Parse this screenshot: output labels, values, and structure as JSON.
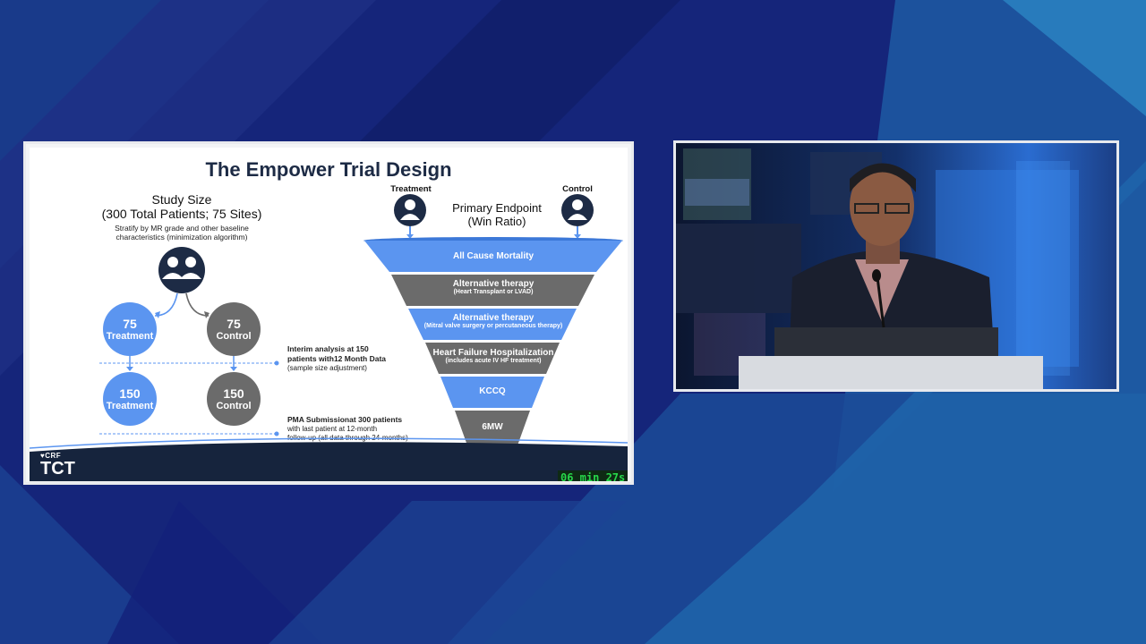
{
  "slide": {
    "title": "The Empower Trial Design",
    "study_size": {
      "heading_line1": "Study Size",
      "heading_line2": "(300 Total Patients; 75 Sites)",
      "stratify_line1": "Stratify by MR grade and other baseline",
      "stratify_line2": "characteristics (minimization algorithm)"
    },
    "arms": {
      "stage1": [
        {
          "number": "75",
          "label": "Treatment",
          "color": "#5b95f0"
        },
        {
          "number": "75",
          "label": "Control",
          "color": "#6b6b6b"
        }
      ],
      "stage2": [
        {
          "number": "150",
          "label": "Treatment",
          "color": "#5b95f0"
        },
        {
          "number": "150",
          "label": "Control",
          "color": "#6b6b6b"
        }
      ]
    },
    "interim": {
      "line1": "Interim analysis at 150",
      "line2": "patients with12 Month Data",
      "line3": "(sample size adjustment)"
    },
    "pma": {
      "line1": "PMA Submissionat 300 patients",
      "line2": "with last patient at 12-month",
      "line3": "follow-up (all data through 24-months)"
    },
    "endpoint": {
      "treatment_label": "Treatment",
      "control_label": "Control",
      "title_line1": "Primary Endpoint",
      "title_line2": "(Win Ratio)"
    },
    "funnel": [
      {
        "label": "All Cause Mortality",
        "sub": "",
        "color": "#5b95f0"
      },
      {
        "label": "Alternative therapy",
        "sub": "(Heart Transplant or LVAD)",
        "color": "#6b6b6b"
      },
      {
        "label": "Alternative therapy",
        "sub": "(Mitral valve surgery or percutaneous therapy)",
        "color": "#5b95f0"
      },
      {
        "label": "Heart Failure Hospitalization",
        "sub": "(includes acute IV HF treatment)",
        "color": "#6b6b6b"
      },
      {
        "label": "KCCQ",
        "sub": "",
        "color": "#5b95f0"
      },
      {
        "label": "6MW",
        "sub": "",
        "color": "#6b6b6b"
      }
    ],
    "logo": {
      "crf": "CRF",
      "tct": "TCT"
    },
    "timer": "06 min 27s"
  },
  "colors": {
    "background": "#15257a",
    "accent_blue": "#5b95f0",
    "dark_navy": "#1d2b45",
    "timer_green": "#27d84a"
  },
  "video": {
    "description_icon": "speaker-video-feed"
  }
}
